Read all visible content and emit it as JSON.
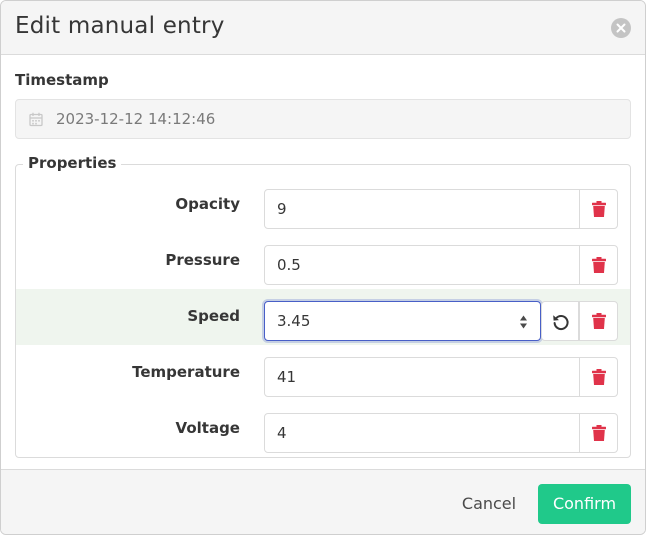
{
  "dialog": {
    "title": "Edit manual entry"
  },
  "timestamp": {
    "label": "Timestamp",
    "value": "2023-12-12 14:12:46"
  },
  "properties": {
    "legend": "Properties",
    "rows": [
      {
        "label": "Opacity",
        "value": "9"
      },
      {
        "label": "Pressure",
        "value": "0.5"
      },
      {
        "label": "Speed",
        "value": "3.45",
        "edited": true
      },
      {
        "label": "Temperature",
        "value": "41"
      },
      {
        "label": "Voltage",
        "value": "4"
      }
    ]
  },
  "footer": {
    "cancel_label": "Cancel",
    "confirm_label": "Confirm"
  },
  "colors": {
    "accent": "#20c98a",
    "delete": "#e0334a",
    "focus": "#485fc7",
    "edited_row": "#eff5ee"
  }
}
